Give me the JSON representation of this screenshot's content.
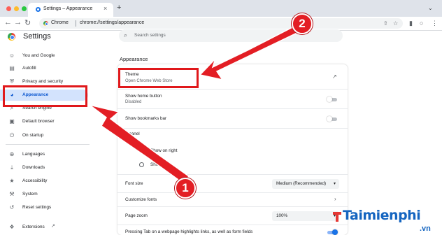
{
  "window": {
    "tab_title": "Settings – Appearance",
    "tab_close": "×",
    "new_tab": "+",
    "menu": "⌄",
    "traffic_colors": [
      "#ff5f57",
      "#febc2e",
      "#28c840"
    ]
  },
  "toolbar": {
    "back": "←",
    "forward": "→",
    "reload": "↻",
    "omnibox_label": "Chrome",
    "url": "chrome://settings/appearance",
    "icons": [
      "share-icon",
      "bookmark-star-icon",
      "sidepanel-icon",
      "profile-icon",
      "menu-icon"
    ],
    "icon_glyphs": [
      "⇧",
      "☆",
      "▮",
      "○",
      "⋮"
    ]
  },
  "header": {
    "title": "Settings",
    "search_placeholder": "Search settings",
    "search_glyph": "⌕"
  },
  "sidebar": {
    "items": [
      {
        "label": "You and Google",
        "icon": "person-icon",
        "glyph": "☺"
      },
      {
        "label": "Autofill",
        "icon": "clipboard-icon",
        "glyph": "▤"
      },
      {
        "label": "Privacy and security",
        "icon": "shield-icon",
        "glyph": "⛨"
      },
      {
        "label": "Appearance",
        "icon": "palette-icon",
        "glyph": "◕",
        "active": true
      },
      {
        "label": "Search engine",
        "icon": "search-icon",
        "glyph": "⌕"
      },
      {
        "label": "Default browser",
        "icon": "browser-icon",
        "glyph": "▣"
      },
      {
        "label": "On startup",
        "icon": "power-icon",
        "glyph": "⏻"
      },
      {
        "label": "Languages",
        "icon": "globe-icon",
        "glyph": "⊕"
      },
      {
        "label": "Downloads",
        "icon": "download-icon",
        "glyph": "⤓"
      },
      {
        "label": "Accessibility",
        "icon": "accessibility-icon",
        "glyph": "★"
      },
      {
        "label": "System",
        "icon": "wrench-icon",
        "glyph": "⚒"
      },
      {
        "label": "Reset settings",
        "icon": "reset-icon",
        "glyph": "↺"
      },
      {
        "label": "Extensions",
        "icon": "puzzle-icon",
        "glyph": "❖"
      }
    ],
    "external_glyph": "↗"
  },
  "appearance": {
    "section_title": "Appearance",
    "theme_title": "Theme",
    "theme_sub": "Open Chrome Web Store",
    "open_glyph": "↗",
    "home_title": "Show home button",
    "home_sub": "Disabled",
    "bookmarks_title": "Show bookmarks bar",
    "panel_title": "e panel",
    "panel_right": "Show on right",
    "panel_left": "Sho  left",
    "font_size_label": "Font size",
    "font_size_value": "Medium (Recommended)",
    "customize_fonts": "Customize fonts",
    "page_zoom_label": "Page zoom",
    "page_zoom_value": "100%",
    "tab_highlight": "Pressing Tab on a webpage highlights links, as well as form fields",
    "caret": "▾",
    "chevron": "›"
  },
  "annotations": {
    "badge_1": "1",
    "badge_2": "2",
    "color": "#e0181b"
  },
  "watermark": {
    "brand": "Taimienphi",
    "domain": ".vn"
  }
}
